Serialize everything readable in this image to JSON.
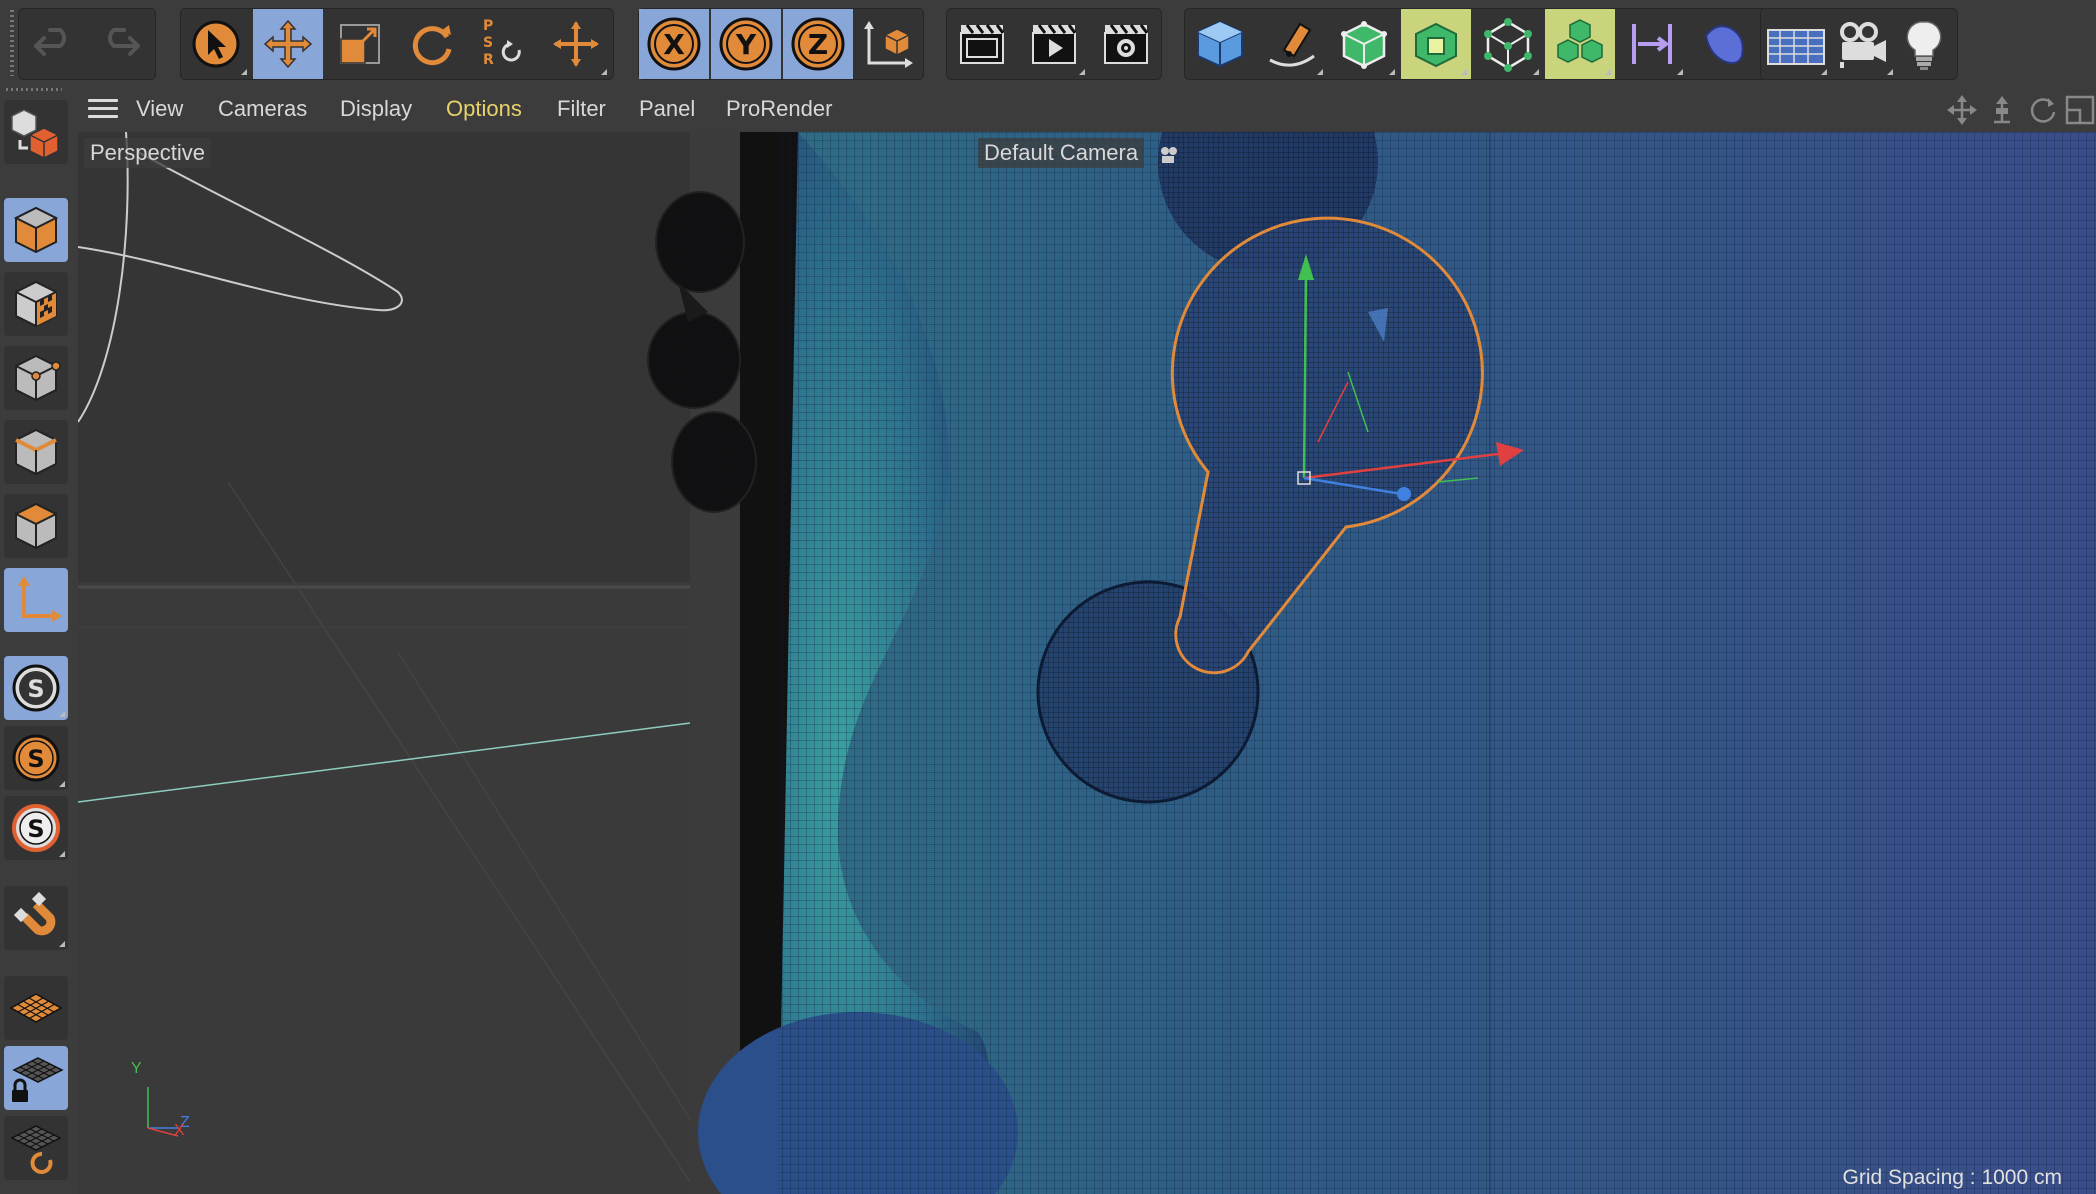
{
  "toolbar": {
    "undo_icon": "undo-icon",
    "redo_icon": "redo-icon",
    "tools": [
      "select-icon",
      "move-icon",
      "scale-icon",
      "rotate-icon",
      "psr-icon",
      "axis-move-icon"
    ],
    "psr_letters": "PSR",
    "axis_locks": [
      "X",
      "Y",
      "Z"
    ],
    "coordinate_icon": "coordinate-system-icon",
    "render_buttons": [
      "render-view-icon",
      "render-to-picture-viewer-icon",
      "render-settings-icon"
    ],
    "object_buttons": [
      "cube-icon",
      "pen-icon",
      "subdivision-icon",
      "extrude-icon",
      "cloner-icon",
      "mograph-icon",
      "deformer-icon",
      "sweep-icon",
      "floor-icon",
      "camera-icon",
      "light-icon"
    ]
  },
  "sidebar": {
    "buttons": [
      "make-editable-icon",
      "model-mode-icon",
      "texture-mode-icon",
      "point-mode-icon",
      "edge-mode-icon",
      "polygon-mode-icon",
      "axis-mode-icon",
      "snap-icon",
      "snap-settings-icon",
      "snap-enable-icon",
      "magnet-icon",
      "workplane-icon",
      "locked-workplane-icon",
      "workplane-settings-icon"
    ],
    "snap_letter": "S"
  },
  "menubar": {
    "items": [
      "View",
      "Cameras",
      "Display",
      "Options",
      "Filter",
      "Panel",
      "ProRender"
    ],
    "highlighted": "Options",
    "nav_icons": [
      "pan-icon",
      "dolly-icon",
      "orbit-icon",
      "maximize-icon"
    ]
  },
  "viewport": {
    "view_name": "Perspective",
    "camera_name": "Default Camera",
    "grid_spacing": "Grid Spacing : 1000 cm",
    "axis_labels": {
      "y": "Y",
      "x": "X",
      "z": "Z"
    }
  },
  "colors": {
    "accent_blue": "#88a6d8",
    "accent_yellow": "#c9d47c",
    "selection_orange": "#e08a3a",
    "menu_highlight": "#e8d36a",
    "axis_x": "#e04040",
    "axis_y": "#40c050",
    "axis_z": "#4080e0"
  }
}
